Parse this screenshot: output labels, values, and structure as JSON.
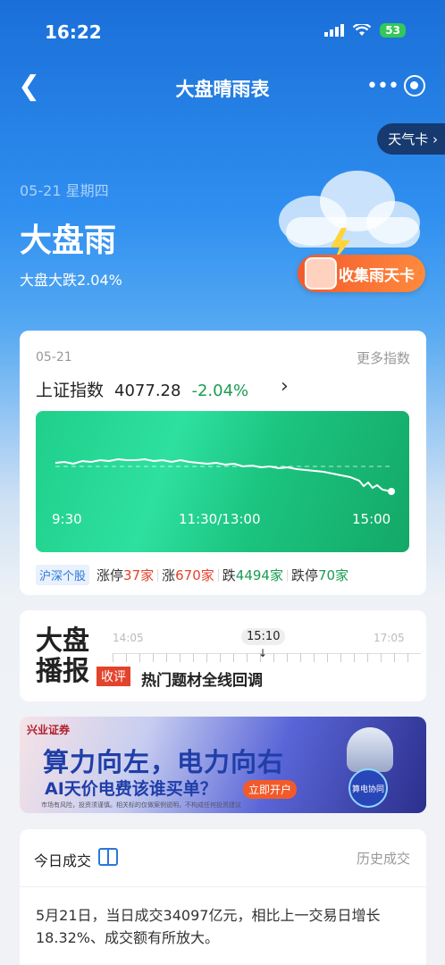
{
  "status": {
    "time": "16:22",
    "battery": "53"
  },
  "nav": {
    "title": "大盘晴雨表"
  },
  "weather_card": "天气卡",
  "hero": {
    "date": "05-21 星期四",
    "title": "大盘雨",
    "subtitle": "大盘大跌2.04%",
    "collect_label": "收集雨天卡"
  },
  "market": {
    "date": "05-21",
    "more_label": "更多指数",
    "index_name": "上证指数",
    "index_value": "4077.28",
    "index_change": "-2.04%",
    "time_start": "9:30",
    "time_mid": "11:30/13:00",
    "time_end": "15:00",
    "stats_tag": "沪深个股",
    "limit_up_label": "涨停",
    "limit_up": "37家",
    "up_label": "涨",
    "up": "670家",
    "down_label": "跌",
    "down": "4494家",
    "limit_down_label": "跌停",
    "limit_down": "70家"
  },
  "broadcast": {
    "title_line1": "大盘",
    "title_line2": "播报",
    "times": [
      "14:05",
      "15:10",
      "17:05"
    ],
    "tag": "收评",
    "headline": "热门题材全线回调"
  },
  "ad": {
    "logo": "兴业证券",
    "line1": "算力向左，电力向右",
    "line2": "AI天价电费该谁买单？",
    "cta": "立即开户",
    "disclaimer": "市场有风险，投资须谨慎。相关标的仅做案例说明，不构成任何投资建议",
    "badge": "算电协同"
  },
  "turnover": {
    "title": "今日成交",
    "history_label": "历史成交",
    "text": "5月21日，当日成交34097亿元，相比上一交易日增长18.32%、成交额有所放大。"
  },
  "colors": {
    "up": "#e3432c",
    "down": "#1a9c52",
    "accent": "#2a78d8"
  }
}
